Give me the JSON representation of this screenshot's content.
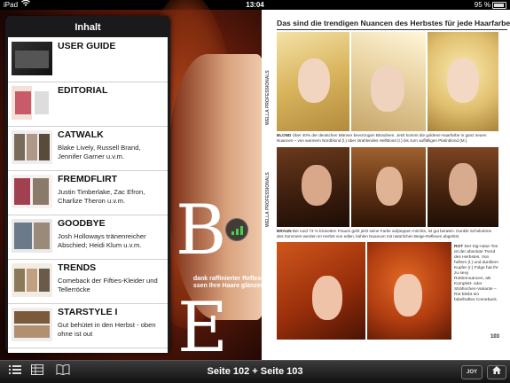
{
  "status_bar": {
    "device": "iPad",
    "wifi_icon": "wifi-icon",
    "time": "13:04",
    "battery_text": "95 %"
  },
  "left_page": {
    "big_letter_top": "B",
    "big_letter_bottom": "E",
    "tagline_line1": "dank raffinierter Reflexe",
    "tagline_line2": "ssen Ihre Haare glänzen"
  },
  "right_page": {
    "title": "Das sind die trendigen Nuancen des Herbstes für jede Haarfarbe",
    "brand_label": "WELLA PROFESSIONALS",
    "caption_blond_head": "BLOND",
    "caption_blond": "Über 40% der deutschen Männer bevorzugen Blondinen. Jetzt kommt die goldene Haarfarbe in ganz neuen Nuancen – von warmem Nordblond (l.) über strahlendes Hellblond (r.) bis zum auffälligen Platinblond (M.)",
    "caption_braun_head": "BRAUN",
    "caption_braun": "Bei rund 73 % brünetten Frauen geht jetzt seine Farbe aufpeppen möchte, ist gut beraten. Dunkle Schokotöne des Sommers werden im Herbst von edlen, kühlen Nuancen mit natürlichen Beige-Reflexen abgelöst.",
    "side_text_head": "ROT",
    "side_text": "Der Sig-natur-Ton ist der absolute Trend des Herbstes. Von hellem (l.) und dunklem Kupfer (r.) Folge hat Ihr zu sexy Rottönnuancen, als Komplett- oder Strähnchen-Variante – Rot bleibt ein fabelhaftes Comeback.",
    "page_number": "103"
  },
  "toc": {
    "title": "Inhalt",
    "items": [
      {
        "heading": "USER GUIDE",
        "sub": ""
      },
      {
        "heading": "EDITORIAL",
        "sub": ""
      },
      {
        "heading": "CATWALK",
        "sub": "Blake Lively, Russell Brand, Jennifer Garner u.v.m."
      },
      {
        "heading": "FREMDFLIRT",
        "sub": "Justin Timberlake, Zac Efron, Charlize Theron u.v.m."
      },
      {
        "heading": "GOODBYE",
        "sub": "Josh Holloways tränenreicher Abschied; Heidi Klum u.v.m."
      },
      {
        "heading": "TRENDS",
        "sub": "Comeback der Fifties-Kleider und Tellerröcke"
      },
      {
        "heading": "STARSTYLE I",
        "sub": "Gut behütet in den Herbst - oben ohne ist out"
      }
    ]
  },
  "toolbar": {
    "page_label": "Seite 102 + Seite 103",
    "joy_label": "JOY",
    "icons": [
      "list-icon",
      "grid-icon",
      "book-icon",
      "home-icon"
    ]
  },
  "colors": {
    "accent_green": "#47d14b",
    "toolbar_dark": "#111111"
  }
}
